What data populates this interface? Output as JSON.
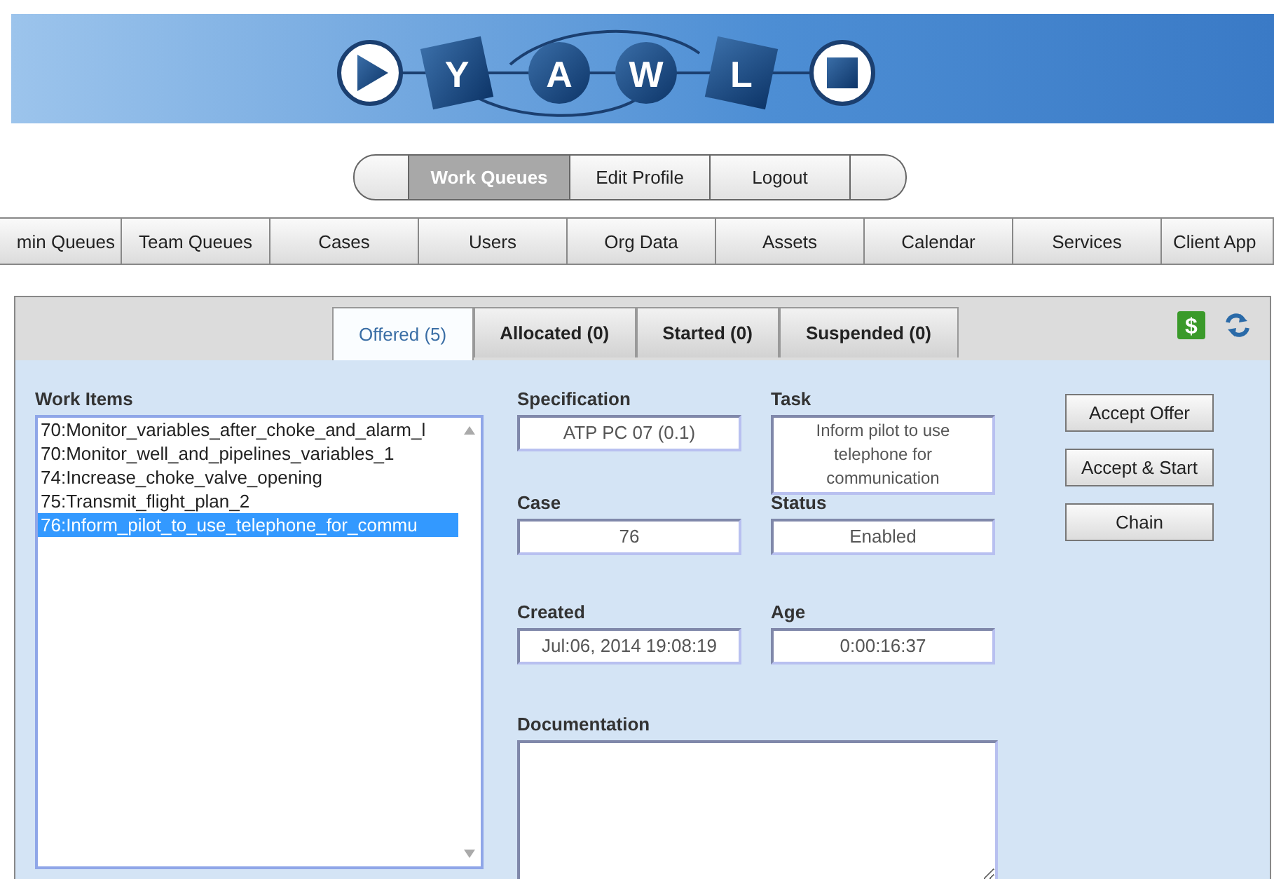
{
  "logo": {
    "letters": [
      "Y",
      "A",
      "W",
      "L"
    ]
  },
  "top_nav": [
    {
      "kind": "cap",
      "selected": false
    },
    {
      "kind": "tab",
      "label": "Work Queues",
      "selected": true
    },
    {
      "kind": "tab",
      "label": "Edit Profile",
      "selected": false
    },
    {
      "kind": "tab",
      "label": "Logout",
      "selected": false
    },
    {
      "kind": "cap",
      "selected": false
    }
  ],
  "money_icon": {
    "glyph": "$"
  },
  "main_nav": [
    {
      "label": "min Queues"
    },
    {
      "label": "Team Queues"
    },
    {
      "label": "Cases"
    },
    {
      "label": "Users"
    },
    {
      "label": "Org Data"
    },
    {
      "label": "Assets"
    },
    {
      "label": "Calendar"
    },
    {
      "label": "Services"
    },
    {
      "label": "Client App"
    }
  ],
  "tabs": [
    {
      "label": "Offered (5)",
      "selected": true
    },
    {
      "label": "Allocated (0)",
      "selected": false
    },
    {
      "label": "Started (0)",
      "selected": false
    },
    {
      "label": "Suspended (0)",
      "selected": false
    }
  ],
  "work_items": {
    "label": "Work Items",
    "items": [
      {
        "text": "70:Monitor_variables_after_choke_and_alarm_l",
        "selected": false
      },
      {
        "text": "70:Monitor_well_and_pipelines_variables_1",
        "selected": false
      },
      {
        "text": "74:Increase_choke_valve_opening",
        "selected": false
      },
      {
        "text": "75:Transmit_flight_plan_2",
        "selected": false
      },
      {
        "text": "76:Inform_pilot_to_use_telephone_for_commu",
        "selected": true
      }
    ]
  },
  "fields": [
    {
      "label": "Specification",
      "value": "ATP PC 07 (0.1)"
    },
    {
      "label": "Task",
      "value": "Inform pilot to use telephone for communication"
    },
    {
      "label": "Case",
      "value": "76"
    },
    {
      "label": "Status",
      "value": "Enabled"
    },
    {
      "label": "Created",
      "value": "Jul:06, 2014 19:08:19"
    },
    {
      "label": "Age",
      "value": "0:00:16:37"
    }
  ],
  "documentation": {
    "label": "Documentation"
  },
  "buttons": [
    "Accept Offer",
    "Accept & Start",
    "Chain"
  ]
}
